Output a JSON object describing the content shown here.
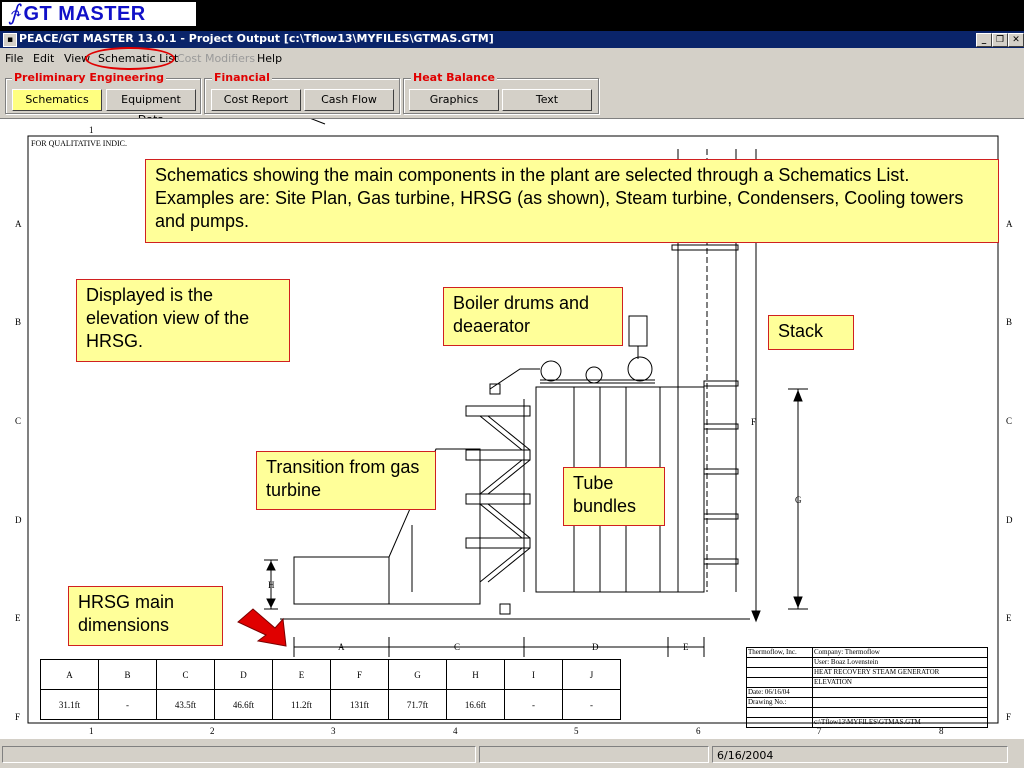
{
  "banner": {
    "logo_mark": "∱",
    "title": "GT MASTER"
  },
  "window": {
    "title": "PEACE/GT MASTER 13.0.1 - Project Output [c:\\Tflow13\\MYFILES\\GTMAS.GTM]",
    "controls": {
      "minimize": "_",
      "restore": "❐",
      "close": "✕"
    }
  },
  "menu": [
    "File",
    "Edit",
    "View",
    "Schematic List",
    "Cost Modifiers",
    "Help"
  ],
  "toolbar": {
    "preliminary_engineering": {
      "label": "Preliminary Engineering",
      "buttons": [
        "Schematics",
        "Equipment Data"
      ]
    },
    "financial": {
      "label": "Financial",
      "buttons": [
        "Cost Report",
        "Cash Flow"
      ]
    },
    "heat_balance": {
      "label": "Heat Balance",
      "buttons": [
        "Graphics",
        "Text"
      ]
    }
  },
  "drawing": {
    "header_note": "FOR QUALITATIVE INDIC.",
    "column_ticks": [
      "1",
      "2",
      "3",
      "4",
      "5",
      "6",
      "7",
      "8"
    ],
    "row_ticks": [
      "A",
      "B",
      "C",
      "D",
      "E",
      "F"
    ],
    "dimension_labels": {
      "A": "A",
      "C": "C",
      "D": "D",
      "E": "E",
      "F": "F",
      "G": "G",
      "H": "H"
    },
    "dimension_table": {
      "headers": [
        "A",
        "B",
        "C",
        "D",
        "E",
        "F",
        "G",
        "H",
        "I",
        "J"
      ],
      "values": [
        "31.1ft",
        "-",
        "43.5ft",
        "46.6ft",
        "11.2ft",
        "131ft",
        "71.7ft",
        "16.6ft",
        "-",
        "-"
      ]
    },
    "title_block": {
      "company_left": "Thermoflow, Inc.",
      "company": "Company: Thermoflow",
      "user": "User: Boaz Lovenstein",
      "title1": "HEAT RECOVERY STEAM GENERATOR",
      "title2": "ELEVATION",
      "date": "Date: 06/16/04",
      "drawing_no": "Drawing No.:",
      "path": "c:\\Tflow13\\MYFILES\\GTMAS.GTM"
    }
  },
  "callouts": {
    "schematics": "Schematics showing the main components in the plant are selected through a Schematics List.  Examples are: Site Plan, Gas turbine, HRSG (as shown), Steam turbine, Condensers, Cooling towers and pumps.",
    "elevation": "Displayed is the elevation view of the HRSG.",
    "boiler": "Boiler drums and deaerator",
    "stack": "Stack",
    "transition": "Transition from gas turbine",
    "tube": "Tube bundles",
    "dimensions": "HRSG main dimensions"
  },
  "status": {
    "date": "6/16/2004"
  },
  "colors": {
    "accent_red": "#e00000",
    "callout_bg": "#ffff99",
    "titlebar": "#0a246a",
    "logo_blue": "#1010c8"
  }
}
